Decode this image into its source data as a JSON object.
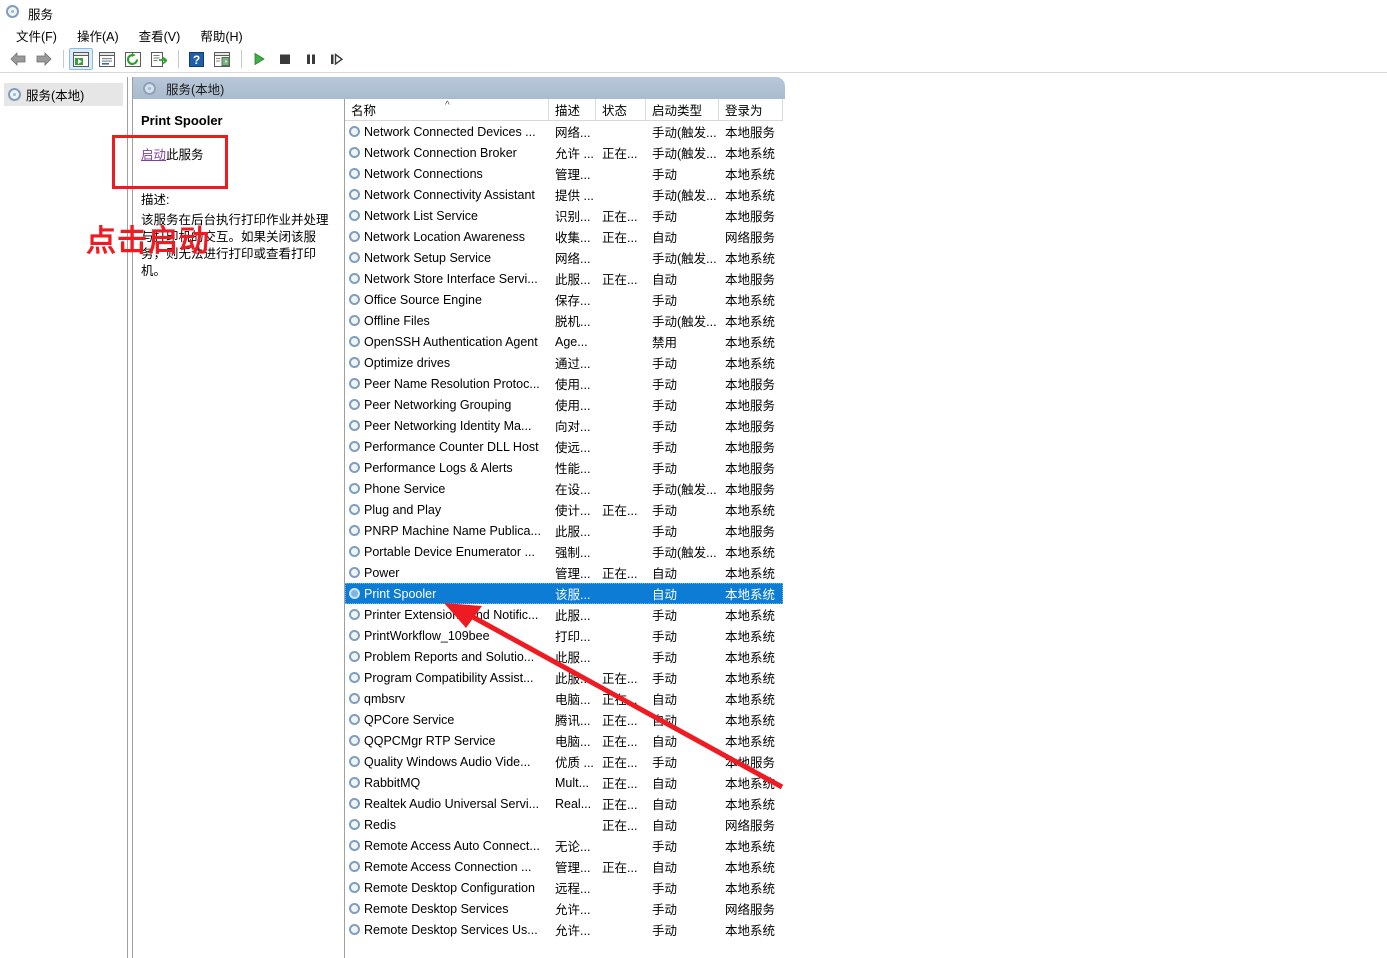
{
  "window": {
    "title": "服务",
    "icon": "services-gear-icon"
  },
  "menubar": [
    {
      "label": "文件(F)",
      "mnemonic": "F"
    },
    {
      "label": "操作(A)",
      "mnemonic": "A"
    },
    {
      "label": "查看(V)",
      "mnemonic": "V"
    },
    {
      "label": "帮助(H)",
      "mnemonic": "H"
    }
  ],
  "toolbar": [
    {
      "name": "back-button",
      "icon": "left-arrow-icon",
      "active": false
    },
    {
      "name": "forward-button",
      "icon": "right-arrow-icon",
      "active": false
    },
    {
      "name": "separator-1",
      "icon": "separator",
      "active": false
    },
    {
      "name": "show-hide-tree-button",
      "icon": "tree-panel-icon",
      "active": true
    },
    {
      "name": "properties-button",
      "icon": "properties-icon",
      "active": false
    },
    {
      "name": "refresh-button",
      "icon": "refresh-icon",
      "active": false
    },
    {
      "name": "export-list-button",
      "icon": "export-list-icon",
      "active": false
    },
    {
      "name": "separator-2",
      "icon": "separator",
      "active": false
    },
    {
      "name": "help-button",
      "icon": "question-mark-icon",
      "active": false
    },
    {
      "name": "show-details-button",
      "icon": "details-panel-icon",
      "active": false
    },
    {
      "name": "separator-3",
      "icon": "separator",
      "active": false
    },
    {
      "name": "start-service-button",
      "icon": "play-icon",
      "active": false
    },
    {
      "name": "stop-service-button",
      "icon": "stop-icon",
      "active": false
    },
    {
      "name": "pause-service-button",
      "icon": "pause-icon",
      "active": false
    },
    {
      "name": "restart-service-button",
      "icon": "step-icon",
      "active": false
    }
  ],
  "tree": {
    "items": [
      {
        "label": "服务(本地)",
        "selected": true
      }
    ]
  },
  "pane_header": {
    "label": "服务(本地)"
  },
  "details": {
    "service_name": "Print Spooler",
    "action_link": "启动",
    "action_suffix": "此服务",
    "description_label": "描述:",
    "description_text": "该服务在后台执行打印作业并处理与打印机的交互。如果关闭该服务，则无法进行打印或查看打印机。"
  },
  "list": {
    "columns": [
      {
        "key": "name",
        "label": "名称",
        "sorted": "asc"
      },
      {
        "key": "desc",
        "label": "描述",
        "sorted": ""
      },
      {
        "key": "status",
        "label": "状态",
        "sorted": ""
      },
      {
        "key": "start",
        "label": "启动类型",
        "sorted": ""
      },
      {
        "key": "logon",
        "label": "登录为",
        "sorted": ""
      }
    ],
    "rows": [
      {
        "name": "Network Connected Devices ...",
        "desc": "网络...",
        "status": "",
        "start": "手动(触发...",
        "logon": "本地服务",
        "selected": false
      },
      {
        "name": "Network Connection Broker",
        "desc": "允许 ...",
        "status": "正在...",
        "start": "手动(触发...",
        "logon": "本地系统",
        "selected": false
      },
      {
        "name": "Network Connections",
        "desc": "管理...",
        "status": "",
        "start": "手动",
        "logon": "本地系统",
        "selected": false
      },
      {
        "name": "Network Connectivity Assistant",
        "desc": "提供 ...",
        "status": "",
        "start": "手动(触发...",
        "logon": "本地系统",
        "selected": false
      },
      {
        "name": "Network List Service",
        "desc": "识别...",
        "status": "正在...",
        "start": "手动",
        "logon": "本地服务",
        "selected": false
      },
      {
        "name": "Network Location Awareness",
        "desc": "收集...",
        "status": "正在...",
        "start": "自动",
        "logon": "网络服务",
        "selected": false
      },
      {
        "name": "Network Setup Service",
        "desc": "网络...",
        "status": "",
        "start": "手动(触发...",
        "logon": "本地系统",
        "selected": false
      },
      {
        "name": "Network Store Interface Servi...",
        "desc": "此服...",
        "status": "正在...",
        "start": "自动",
        "logon": "本地服务",
        "selected": false
      },
      {
        "name": "Office  Source Engine",
        "desc": "保存...",
        "status": "",
        "start": "手动",
        "logon": "本地系统",
        "selected": false
      },
      {
        "name": "Offline Files",
        "desc": "脱机...",
        "status": "",
        "start": "手动(触发...",
        "logon": "本地系统",
        "selected": false
      },
      {
        "name": "OpenSSH Authentication Agent",
        "desc": "Age...",
        "status": "",
        "start": "禁用",
        "logon": "本地系统",
        "selected": false
      },
      {
        "name": "Optimize drives",
        "desc": "通过...",
        "status": "",
        "start": "手动",
        "logon": "本地系统",
        "selected": false
      },
      {
        "name": "Peer Name Resolution Protoc...",
        "desc": "使用...",
        "status": "",
        "start": "手动",
        "logon": "本地服务",
        "selected": false
      },
      {
        "name": "Peer Networking Grouping",
        "desc": "使用...",
        "status": "",
        "start": "手动",
        "logon": "本地服务",
        "selected": false
      },
      {
        "name": "Peer Networking Identity Ma...",
        "desc": "向对...",
        "status": "",
        "start": "手动",
        "logon": "本地服务",
        "selected": false
      },
      {
        "name": "Performance Counter DLL Host",
        "desc": "使远...",
        "status": "",
        "start": "手动",
        "logon": "本地服务",
        "selected": false
      },
      {
        "name": "Performance Logs & Alerts",
        "desc": "性能...",
        "status": "",
        "start": "手动",
        "logon": "本地服务",
        "selected": false
      },
      {
        "name": "Phone Service",
        "desc": "在设...",
        "status": "",
        "start": "手动(触发...",
        "logon": "本地服务",
        "selected": false
      },
      {
        "name": "Plug and Play",
        "desc": "使计...",
        "status": "正在...",
        "start": "手动",
        "logon": "本地系统",
        "selected": false
      },
      {
        "name": "PNRP Machine Name Publica...",
        "desc": "此服...",
        "status": "",
        "start": "手动",
        "logon": "本地服务",
        "selected": false
      },
      {
        "name": "Portable Device Enumerator ...",
        "desc": "强制...",
        "status": "",
        "start": "手动(触发...",
        "logon": "本地系统",
        "selected": false
      },
      {
        "name": "Power",
        "desc": "管理...",
        "status": "正在...",
        "start": "自动",
        "logon": "本地系统",
        "selected": false
      },
      {
        "name": "Print Spooler",
        "desc": "该服...",
        "status": "",
        "start": "自动",
        "logon": "本地系统",
        "selected": true
      },
      {
        "name": "Printer Extensions and Notific...",
        "desc": "此服...",
        "status": "",
        "start": "手动",
        "logon": "本地系统",
        "selected": false
      },
      {
        "name": "PrintWorkflow_109bee",
        "desc": "打印...",
        "status": "",
        "start": "手动",
        "logon": "本地系统",
        "selected": false
      },
      {
        "name": "Problem Reports and Solutio...",
        "desc": "此服...",
        "status": "",
        "start": "手动",
        "logon": "本地系统",
        "selected": false
      },
      {
        "name": "Program Compatibility Assist...",
        "desc": "此服...",
        "status": "正在...",
        "start": "手动",
        "logon": "本地系统",
        "selected": false
      },
      {
        "name": "qmbsrv",
        "desc": "电脑...",
        "status": "正在...",
        "start": "自动",
        "logon": "本地系统",
        "selected": false
      },
      {
        "name": "QPCore Service",
        "desc": "腾讯...",
        "status": "正在...",
        "start": "自动",
        "logon": "本地系统",
        "selected": false
      },
      {
        "name": "QQPCMgr RTP Service",
        "desc": "电脑...",
        "status": "正在...",
        "start": "自动",
        "logon": "本地系统",
        "selected": false
      },
      {
        "name": "Quality Windows Audio Vide...",
        "desc": "优质 ...",
        "status": "正在...",
        "start": "手动",
        "logon": "本地服务",
        "selected": false
      },
      {
        "name": "RabbitMQ",
        "desc": "Mult...",
        "status": "正在...",
        "start": "自动",
        "logon": "本地系统",
        "selected": false
      },
      {
        "name": "Realtek Audio Universal Servi...",
        "desc": "Real...",
        "status": "正在...",
        "start": "自动",
        "logon": "本地系统",
        "selected": false
      },
      {
        "name": "Redis",
        "desc": "",
        "status": "正在...",
        "start": "自动",
        "logon": "网络服务",
        "selected": false
      },
      {
        "name": "Remote Access Auto Connect...",
        "desc": "无论...",
        "status": "",
        "start": "手动",
        "logon": "本地系统",
        "selected": false
      },
      {
        "name": "Remote Access Connection ...",
        "desc": "管理...",
        "status": "正在...",
        "start": "自动",
        "logon": "本地系统",
        "selected": false
      },
      {
        "name": "Remote Desktop Configuration",
        "desc": "远程...",
        "status": "",
        "start": "手动",
        "logon": "本地系统",
        "selected": false
      },
      {
        "name": "Remote Desktop Services",
        "desc": "允许...",
        "status": "",
        "start": "手动",
        "logon": "网络服务",
        "selected": false
      },
      {
        "name": "Remote Desktop Services Us...",
        "desc": "允许...",
        "status": "",
        "start": "手动",
        "logon": "本地系统",
        "selected": false
      }
    ]
  },
  "annotations": {
    "highlight_box": {
      "name": "start-service-highlight"
    },
    "overlay_text": "点击启动",
    "arrow": {
      "name": "pointer-arrow",
      "target": "Print Spooler"
    },
    "color": "#ee1c22"
  }
}
